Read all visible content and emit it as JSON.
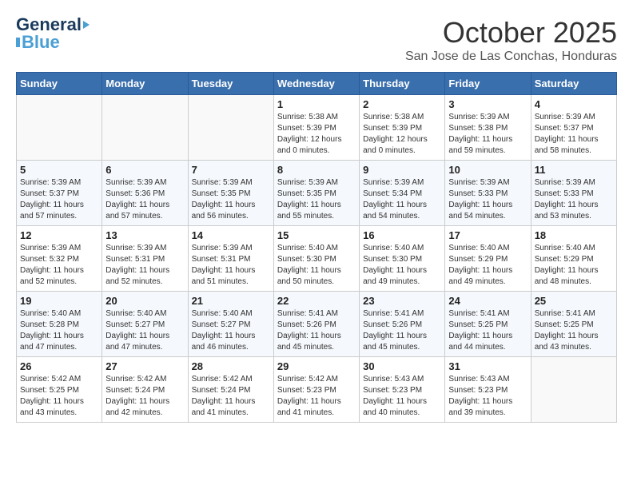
{
  "logo": {
    "line1": "General",
    "line2": "Blue"
  },
  "header": {
    "title": "October 2025",
    "subtitle": "San Jose de Las Conchas, Honduras"
  },
  "weekdays": [
    "Sunday",
    "Monday",
    "Tuesday",
    "Wednesday",
    "Thursday",
    "Friday",
    "Saturday"
  ],
  "weeks": [
    [
      {
        "day": "",
        "info": ""
      },
      {
        "day": "",
        "info": ""
      },
      {
        "day": "",
        "info": ""
      },
      {
        "day": "1",
        "info": "Sunrise: 5:38 AM\nSunset: 5:39 PM\nDaylight: 12 hours\nand 0 minutes."
      },
      {
        "day": "2",
        "info": "Sunrise: 5:38 AM\nSunset: 5:39 PM\nDaylight: 12 hours\nand 0 minutes."
      },
      {
        "day": "3",
        "info": "Sunrise: 5:39 AM\nSunset: 5:38 PM\nDaylight: 11 hours\nand 59 minutes."
      },
      {
        "day": "4",
        "info": "Sunrise: 5:39 AM\nSunset: 5:37 PM\nDaylight: 11 hours\nand 58 minutes."
      }
    ],
    [
      {
        "day": "5",
        "info": "Sunrise: 5:39 AM\nSunset: 5:37 PM\nDaylight: 11 hours\nand 57 minutes."
      },
      {
        "day": "6",
        "info": "Sunrise: 5:39 AM\nSunset: 5:36 PM\nDaylight: 11 hours\nand 57 minutes."
      },
      {
        "day": "7",
        "info": "Sunrise: 5:39 AM\nSunset: 5:35 PM\nDaylight: 11 hours\nand 56 minutes."
      },
      {
        "day": "8",
        "info": "Sunrise: 5:39 AM\nSunset: 5:35 PM\nDaylight: 11 hours\nand 55 minutes."
      },
      {
        "day": "9",
        "info": "Sunrise: 5:39 AM\nSunset: 5:34 PM\nDaylight: 11 hours\nand 54 minutes."
      },
      {
        "day": "10",
        "info": "Sunrise: 5:39 AM\nSunset: 5:33 PM\nDaylight: 11 hours\nand 54 minutes."
      },
      {
        "day": "11",
        "info": "Sunrise: 5:39 AM\nSunset: 5:33 PM\nDaylight: 11 hours\nand 53 minutes."
      }
    ],
    [
      {
        "day": "12",
        "info": "Sunrise: 5:39 AM\nSunset: 5:32 PM\nDaylight: 11 hours\nand 52 minutes."
      },
      {
        "day": "13",
        "info": "Sunrise: 5:39 AM\nSunset: 5:31 PM\nDaylight: 11 hours\nand 52 minutes."
      },
      {
        "day": "14",
        "info": "Sunrise: 5:39 AM\nSunset: 5:31 PM\nDaylight: 11 hours\nand 51 minutes."
      },
      {
        "day": "15",
        "info": "Sunrise: 5:40 AM\nSunset: 5:30 PM\nDaylight: 11 hours\nand 50 minutes."
      },
      {
        "day": "16",
        "info": "Sunrise: 5:40 AM\nSunset: 5:30 PM\nDaylight: 11 hours\nand 49 minutes."
      },
      {
        "day": "17",
        "info": "Sunrise: 5:40 AM\nSunset: 5:29 PM\nDaylight: 11 hours\nand 49 minutes."
      },
      {
        "day": "18",
        "info": "Sunrise: 5:40 AM\nSunset: 5:29 PM\nDaylight: 11 hours\nand 48 minutes."
      }
    ],
    [
      {
        "day": "19",
        "info": "Sunrise: 5:40 AM\nSunset: 5:28 PM\nDaylight: 11 hours\nand 47 minutes."
      },
      {
        "day": "20",
        "info": "Sunrise: 5:40 AM\nSunset: 5:27 PM\nDaylight: 11 hours\nand 47 minutes."
      },
      {
        "day": "21",
        "info": "Sunrise: 5:40 AM\nSunset: 5:27 PM\nDaylight: 11 hours\nand 46 minutes."
      },
      {
        "day": "22",
        "info": "Sunrise: 5:41 AM\nSunset: 5:26 PM\nDaylight: 11 hours\nand 45 minutes."
      },
      {
        "day": "23",
        "info": "Sunrise: 5:41 AM\nSunset: 5:26 PM\nDaylight: 11 hours\nand 45 minutes."
      },
      {
        "day": "24",
        "info": "Sunrise: 5:41 AM\nSunset: 5:25 PM\nDaylight: 11 hours\nand 44 minutes."
      },
      {
        "day": "25",
        "info": "Sunrise: 5:41 AM\nSunset: 5:25 PM\nDaylight: 11 hours\nand 43 minutes."
      }
    ],
    [
      {
        "day": "26",
        "info": "Sunrise: 5:42 AM\nSunset: 5:25 PM\nDaylight: 11 hours\nand 43 minutes."
      },
      {
        "day": "27",
        "info": "Sunrise: 5:42 AM\nSunset: 5:24 PM\nDaylight: 11 hours\nand 42 minutes."
      },
      {
        "day": "28",
        "info": "Sunrise: 5:42 AM\nSunset: 5:24 PM\nDaylight: 11 hours\nand 41 minutes."
      },
      {
        "day": "29",
        "info": "Sunrise: 5:42 AM\nSunset: 5:23 PM\nDaylight: 11 hours\nand 41 minutes."
      },
      {
        "day": "30",
        "info": "Sunrise: 5:43 AM\nSunset: 5:23 PM\nDaylight: 11 hours\nand 40 minutes."
      },
      {
        "day": "31",
        "info": "Sunrise: 5:43 AM\nSunset: 5:23 PM\nDaylight: 11 hours\nand 39 minutes."
      },
      {
        "day": "",
        "info": ""
      }
    ]
  ]
}
